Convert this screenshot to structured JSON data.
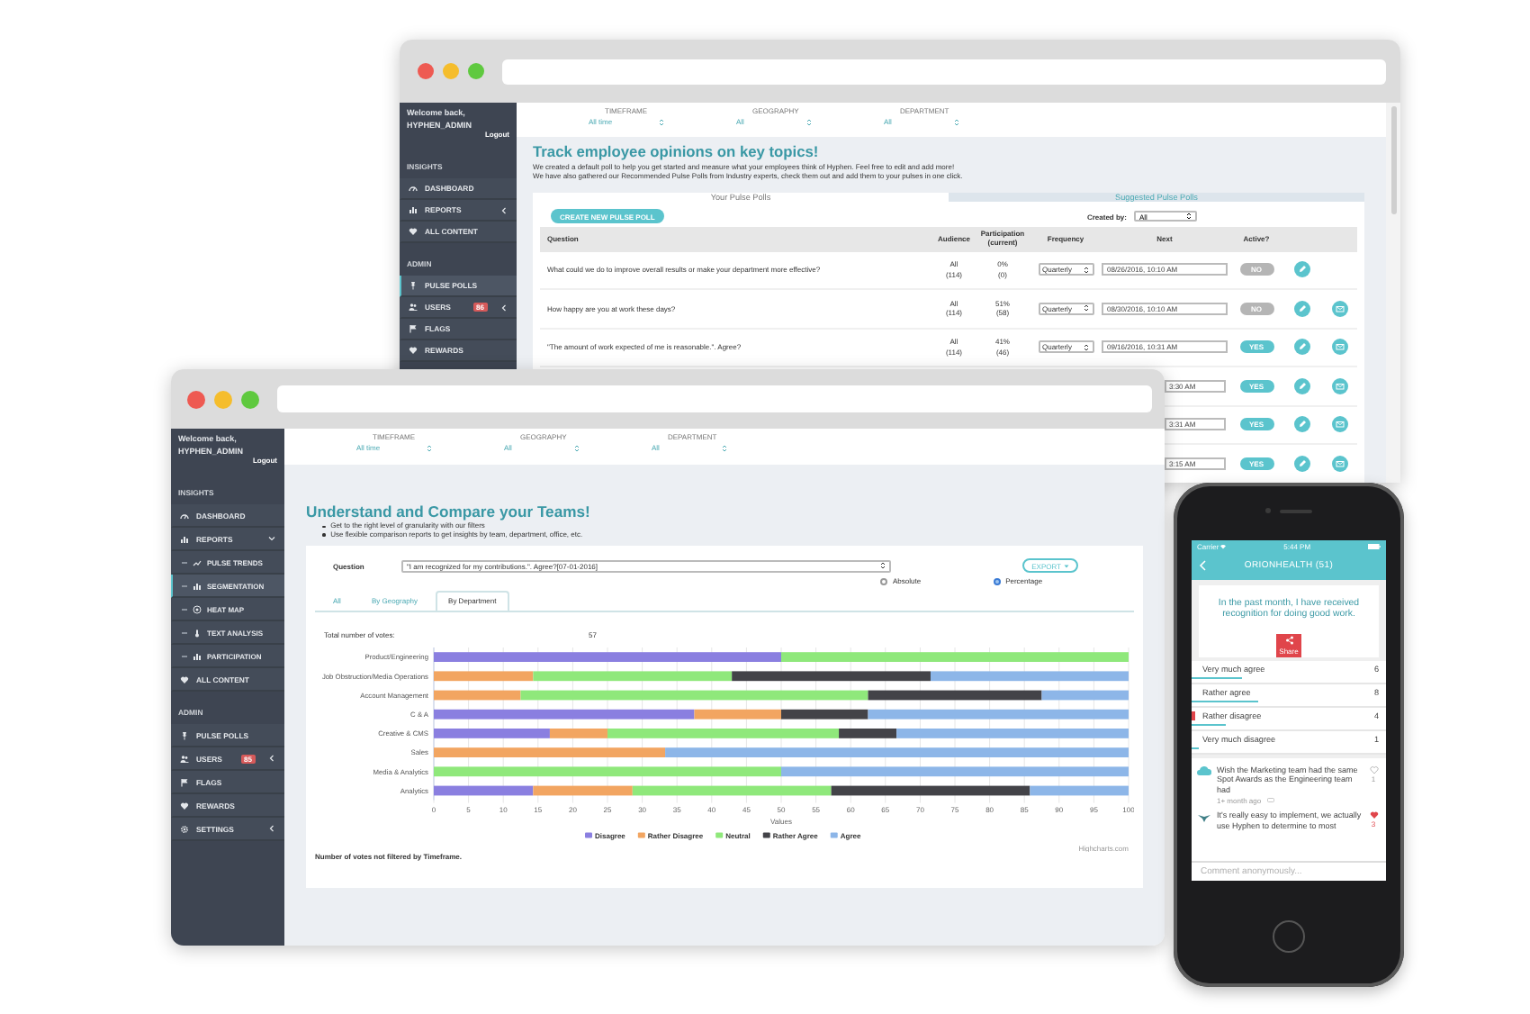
{
  "back_window": {
    "sidebar": {
      "greeting": "Welcome back,",
      "user": "HYPHEN_ADMIN",
      "logout": "Logout",
      "sections": [
        {
          "heading": "INSIGHTS",
          "items": [
            {
              "label": "DASHBOARD",
              "selected": false
            },
            {
              "label": "REPORTS",
              "selected": false,
              "expanded": false
            },
            {
              "label": "ALL CONTENT",
              "selected": false
            }
          ]
        },
        {
          "heading": "ADMIN",
          "items": [
            {
              "label": "PULSE POLLS",
              "selected": true
            },
            {
              "label": "USERS",
              "selected": false,
              "badge": "86",
              "expanded": false
            },
            {
              "label": "FLAGS",
              "selected": false
            },
            {
              "label": "REWARDS",
              "selected": false
            }
          ]
        }
      ]
    },
    "filters": [
      {
        "label": "TIMEFRAME",
        "value": "All time"
      },
      {
        "label": "GEOGRAPHY",
        "value": "All"
      },
      {
        "label": "DEPARTMENT",
        "value": "All"
      }
    ],
    "title": "Track employee opinions on key topics!",
    "description": [
      "We created a default poll to help you get started and measure what your employees think of Hyphen. Feel free to edit and add more!",
      "We have also gathered our Recommended Pulse Polls from Industry experts, check them out and add them to your pulses in one click."
    ],
    "tabs": [
      {
        "label": "Your Pulse Polls",
        "selected": true
      },
      {
        "label": "Suggested Pulse Polls",
        "selected": false
      }
    ],
    "create_button": "CREATE NEW PULSE POLL",
    "created_by": {
      "label": "Created by:",
      "value": "All"
    },
    "poll_table": {
      "columns": [
        "Question",
        "Audience",
        "Participation (current)",
        "Frequency",
        "Next",
        "Active?"
      ],
      "rows": [
        {
          "question": "What could we do to improve overall results or make your department more effective?",
          "audience": "All",
          "audience_size": "(114)",
          "participation": "0%",
          "responses": "(0)",
          "frequency": "Quarterly",
          "next": "08/26/2016, 10:10 AM",
          "active": false,
          "active_label": "NO",
          "mail_button": false
        },
        {
          "question": "How happy are you at work these days?",
          "audience": "All",
          "audience_size": "(114)",
          "participation": "51%",
          "responses": "(58)",
          "frequency": "Quarterly",
          "next": "08/30/2016, 10:10 AM",
          "active": false,
          "active_label": "NO",
          "mail_button": true
        },
        {
          "question": "\"The amount of work expected of me is reasonable.\". Agree?",
          "audience": "All",
          "audience_size": "(114)",
          "participation": "41%",
          "responses": "(46)",
          "frequency": "Quarterly",
          "next": "09/16/2016, 10:31 AM",
          "active": true,
          "active_label": "YES",
          "mail_button": true
        },
        {
          "next": "3:30 AM",
          "active": true,
          "active_label": "YES",
          "mail_button": true
        },
        {
          "next": "3:31 AM",
          "active": true,
          "active_label": "YES",
          "mail_button": true
        },
        {
          "next": "3:15 AM",
          "active": true,
          "active_label": "YES",
          "mail_button": true
        }
      ]
    }
  },
  "front_window": {
    "sidebar": {
      "greeting": "Welcome back,",
      "user": "HYPHEN_ADMIN",
      "logout": "Logout",
      "sections": [
        {
          "heading": "INSIGHTS",
          "items": [
            {
              "label": "DASHBOARD",
              "selected": false
            },
            {
              "label": "REPORTS",
              "selected": false,
              "expanded": true,
              "children": [
                {
                  "label": "PULSE TRENDS",
                  "selected": false
                },
                {
                  "label": "SEGMENTATION",
                  "selected": true
                },
                {
                  "label": "HEAT MAP",
                  "selected": false
                },
                {
                  "label": "TEXT ANALYSIS",
                  "selected": false
                },
                {
                  "label": "PARTICIPATION",
                  "selected": false
                }
              ]
            },
            {
              "label": "ALL CONTENT",
              "selected": false
            }
          ]
        },
        {
          "heading": "ADMIN",
          "items": [
            {
              "label": "PULSE POLLS",
              "selected": false
            },
            {
              "label": "USERS",
              "selected": false,
              "badge": "85",
              "expanded": false
            },
            {
              "label": "FLAGS",
              "selected": false
            },
            {
              "label": "REWARDS",
              "selected": false
            },
            {
              "label": "SETTINGS",
              "selected": false,
              "expanded": false
            }
          ]
        }
      ]
    },
    "filters": [
      {
        "label": "TIMEFRAME",
        "value": "All time"
      },
      {
        "label": "GEOGRAPHY",
        "value": "All"
      },
      {
        "label": "DEPARTMENT",
        "value": "All"
      }
    ],
    "title": "Understand and Compare your Teams!",
    "bullets": [
      "Get to the right level of granularity with our filters",
      "Use flexible comparison reports to get insights by team, department, office, etc."
    ],
    "panel": {
      "question_label": "Question",
      "question_value": "\"I am recognized for my contributions.\". Agree?[07-01-2016]",
      "export_button": "EXPORT",
      "display_modes": [
        {
          "label": "Absolute",
          "selected": false
        },
        {
          "label": "Percentage",
          "selected": true
        }
      ],
      "tabs": [
        {
          "label": "All",
          "selected": false
        },
        {
          "label": "By Geography",
          "selected": false
        },
        {
          "label": "By Department",
          "selected": true
        }
      ],
      "total_label": "Total number of votes:",
      "total_value": "57",
      "chart_data": {
        "type": "bar",
        "orientation": "horizontal",
        "stacked": true,
        "legend": "bottom",
        "grid": true,
        "xlabel": "Values",
        "xlim": [
          0,
          100
        ],
        "xticks": [
          0,
          5,
          10,
          15,
          20,
          25,
          30,
          35,
          40,
          45,
          50,
          55,
          60,
          65,
          70,
          75,
          80,
          85,
          90,
          95,
          100
        ],
        "categories": [
          "Product/Engineering",
          "Job Obstruction/Media Operations",
          "Account Management",
          "C & A",
          "Creative & CMS",
          "Sales",
          "Media & Analytics",
          "Analytics"
        ],
        "series": [
          {
            "name": "Disagree",
            "color": "#8a7fe0",
            "values": [
              50,
              null,
              null,
              37.5,
              16.7,
              null,
              null,
              14.3
            ]
          },
          {
            "name": "Rather Disagree",
            "color": "#f2a561",
            "values": [
              null,
              14.3,
              12.5,
              12.5,
              8.3,
              33.3,
              null,
              14.3
            ]
          },
          {
            "name": "Neutral",
            "color": "#8fe87b",
            "values": [
              50,
              28.6,
              50,
              null,
              33.3,
              null,
              50,
              28.6
            ]
          },
          {
            "name": "Rather Agree",
            "color": "#434348",
            "values": [
              null,
              28.6,
              25,
              12.5,
              8.3,
              null,
              null,
              28.6
            ]
          },
          {
            "name": "Agree",
            "color": "#8db6e8",
            "values": [
              null,
              28.5,
              12.5,
              37.5,
              33.4,
              66.7,
              50,
              14.2
            ]
          }
        ]
      },
      "credit": "Highcharts.com",
      "footnote": "Number of votes not filtered by Timeframe."
    }
  },
  "phone": {
    "carrier": "Carrier",
    "time": "5:44 PM",
    "title": "ORIONHEALTH (51)",
    "question": "In the past month, I have received recognition for doing good work.",
    "share_label": "Share",
    "options": [
      {
        "label": "Very much agree",
        "count": "6",
        "level": 0.27,
        "selected": false
      },
      {
        "label": "Rather agree",
        "count": "8",
        "level": 0.36,
        "selected": false
      },
      {
        "label": "Rather disagree",
        "count": "4",
        "level": 0.18,
        "selected": true
      },
      {
        "label": "Very much disagree",
        "count": "1",
        "level": 0.04,
        "selected": false
      }
    ],
    "comments": [
      {
        "text": "Wish the Marketing team had the same Spot Awards as the Engineering team had",
        "time": "1+ month ago",
        "likes": "1",
        "liked": false
      },
      {
        "text": "It's really easy to implement, we actually use Hyphen to determine to most",
        "likes": "3",
        "liked": true
      }
    ],
    "comment_placeholder": "Comment anonymously..."
  }
}
